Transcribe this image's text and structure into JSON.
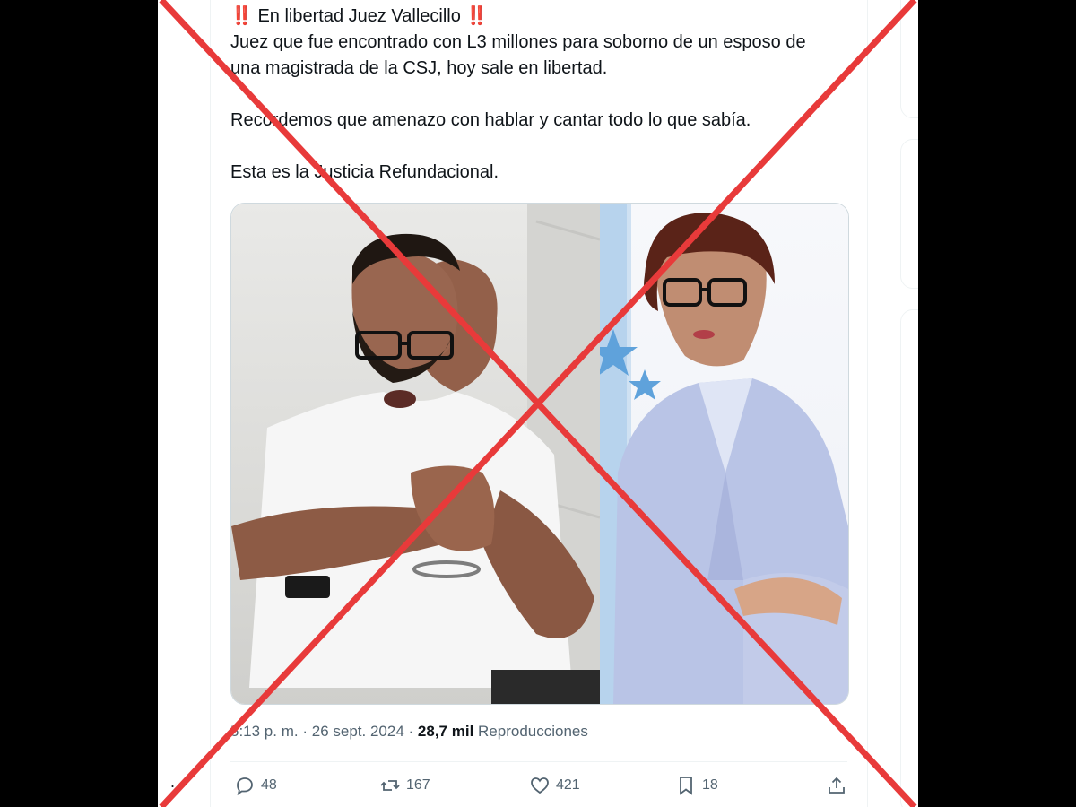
{
  "tweet": {
    "lines": [
      "‼️ En libertad Juez Vallecillo ‼️",
      "Juez que fue encontrado con L3 millones para soborno de un esposo de",
      "una magistrada de la CSJ, hoy sale en libertad."
    ],
    "paragraph2": "Recordemos que amenazo con hablar y cantar todo lo que sabía.",
    "paragraph3": "Esta es la Justicia Refundacional."
  },
  "meta": {
    "time": "5:13 p. m.",
    "separator": "·",
    "date": "26 sept. 2024",
    "views_count": "28,7 mil",
    "views_label": "Reproducciones"
  },
  "actions": {
    "replies": "48",
    "reposts": "167",
    "likes": "421",
    "bookmarks": "18"
  },
  "more_label": "...",
  "colors": {
    "cross": "#e83a3a",
    "text": "#0f1419",
    "muted": "#536471"
  },
  "icons": [
    "reply-icon",
    "repost-icon",
    "like-icon",
    "bookmark-icon",
    "share-icon"
  ]
}
